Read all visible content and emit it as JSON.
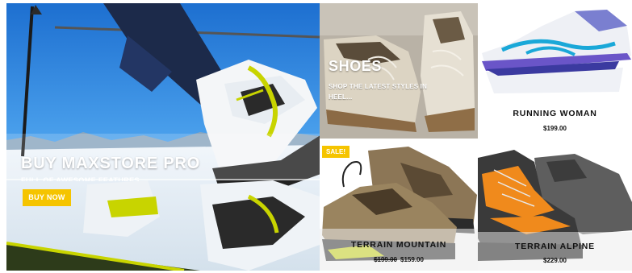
{
  "hero": {
    "title": "BUY MAXSTORE PRO",
    "subtitle": "FULL OF AWESOME FEATURES",
    "button": "BUY NOW"
  },
  "shoes": {
    "title": "SHOES",
    "subtitle": "SHOP THE LATEST STYLES IN HEEL..."
  },
  "products": {
    "running": {
      "name": "RUNNING WOMAN",
      "price": "$199.00"
    },
    "mountain": {
      "badge": "SALE!",
      "name": "TERRAIN MOUNTAIN",
      "old_price": "$199.00",
      "price": "$159.00"
    },
    "alpine": {
      "name": "TERRAIN ALPINE",
      "price": "$229.00"
    }
  },
  "colors": {
    "accent": "#f5c400",
    "sky": "#2f86e0",
    "lime": "#c8d400",
    "orange": "#f08a1c",
    "cyan": "#1aa8d8"
  }
}
